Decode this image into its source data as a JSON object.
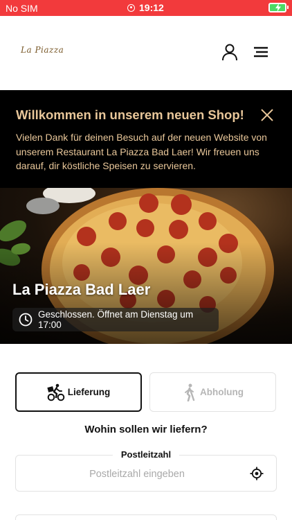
{
  "status_bar": {
    "carrier": "No SIM",
    "time": "19:12"
  },
  "header": {
    "logo": "La Piazza"
  },
  "banner": {
    "title": "Willkommen in unserem neuen Shop!",
    "text": "Vielen Dank für deinen Besuch auf der neuen Website von unserem Restaurant La Piazza Bad Laer! Wir freuen uns darauf, dir köstliche Speisen zu servieren."
  },
  "hero": {
    "title": "La Piazza Bad Laer",
    "status": "Geschlossen. Öffnet am Dienstag um 17:00"
  },
  "order_mode": {
    "delivery_label": "Lieferung",
    "pickup_label": "Abholung",
    "selected": "Lieferung"
  },
  "delivery": {
    "question": "Wohin sollen wir liefern?",
    "zip_label": "Postleitzahl",
    "zip_placeholder": "Postleitzahl eingeben",
    "zip_value": ""
  },
  "colors": {
    "status_bar": "#f23a3c",
    "banner_bg": "#000000",
    "banner_accent": "#e9c79a"
  }
}
